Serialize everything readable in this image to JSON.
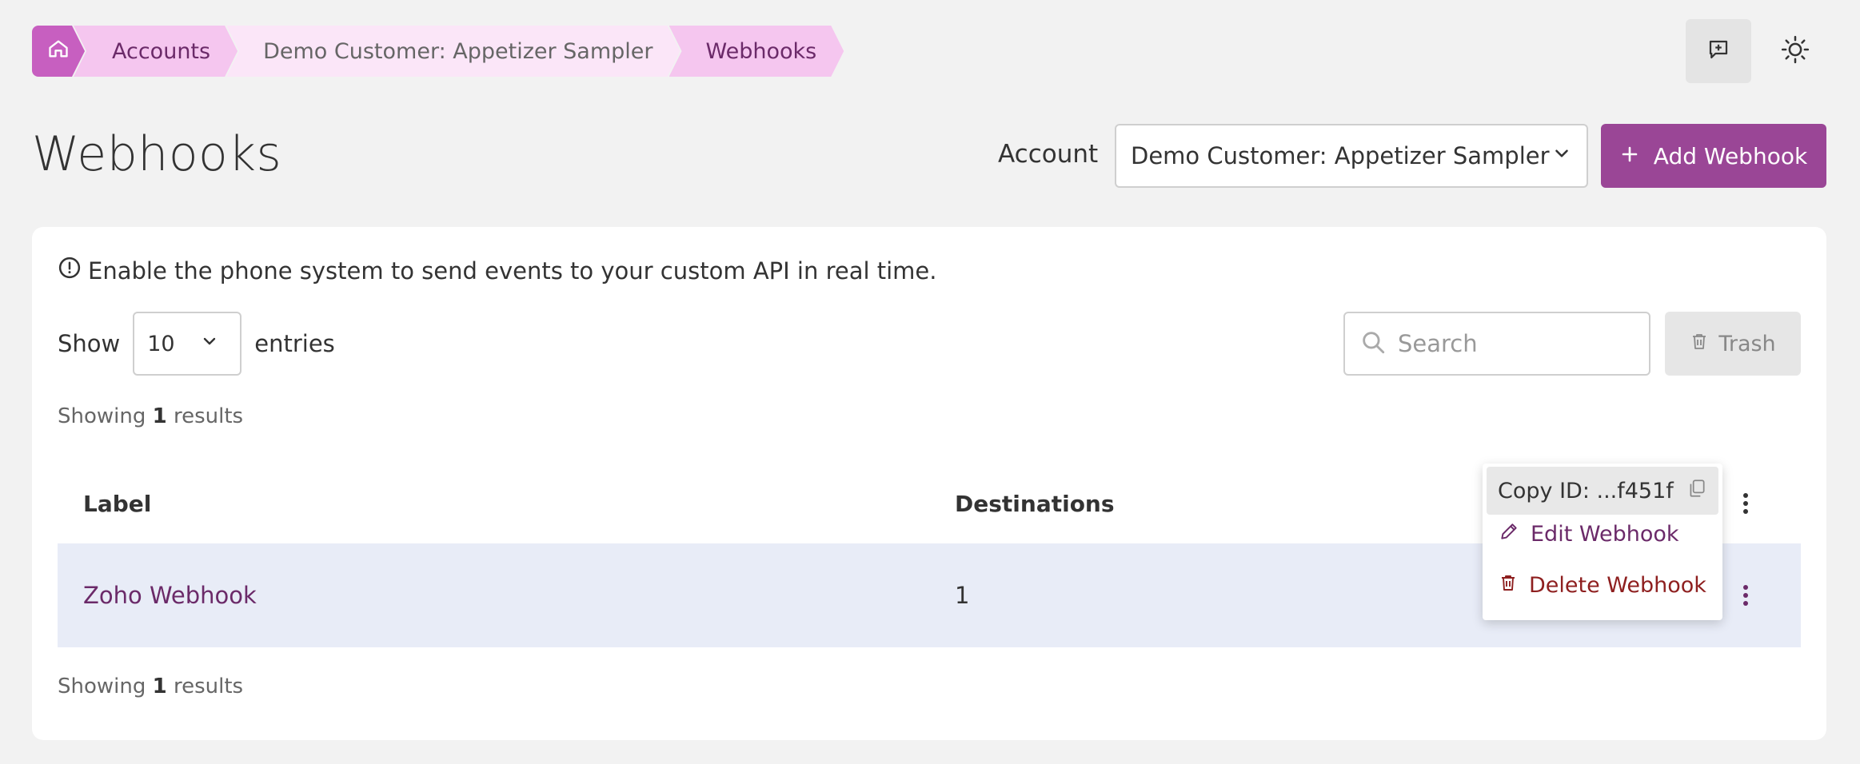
{
  "breadcrumb": {
    "items": [
      {
        "label": "Accounts"
      },
      {
        "label": "Demo Customer: Appetizer Sampler"
      },
      {
        "label": "Webhooks"
      }
    ]
  },
  "header": {
    "title": "Webhooks",
    "account_label": "Account",
    "account_value": "Demo Customer: Appetizer Sampler",
    "add_button": "Add Webhook"
  },
  "info": {
    "text": "Enable the phone system to send events to your custom API in real time."
  },
  "controls": {
    "show_label": "Show",
    "entries_value": "10",
    "entries_label": "entries",
    "search_placeholder": "Search",
    "trash_label": "Trash"
  },
  "results": {
    "prefix": "Showing",
    "count": "1",
    "suffix": "results"
  },
  "table": {
    "columns": [
      "Label",
      "Destinations"
    ],
    "rows": [
      {
        "label": "Zoho Webhook",
        "destinations": "1"
      }
    ]
  },
  "menu": {
    "copy_id": "Copy ID: ...f451f",
    "edit": "Edit Webhook",
    "delete": "Delete Webhook"
  },
  "colors": {
    "brand": "#9a4696",
    "crumb_active": "#f5c6ef",
    "row_highlight": "#e8ecf7",
    "danger": "#8e1f1f"
  }
}
